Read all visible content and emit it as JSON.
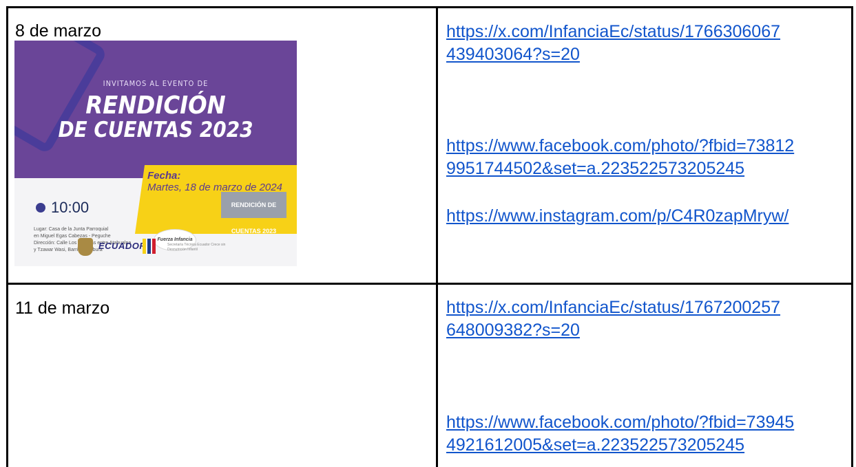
{
  "rows": [
    {
      "date": "8 de marzo",
      "poster": {
        "invite": "INVITAMOS AL EVENTO DE",
        "title_line1": "RENDICIÓN",
        "title_line2": "DE CUENTAS 2023",
        "time": "10:00",
        "fecha_label": "Fecha:",
        "fecha_value": "Martes, 18 de marzo de 2024",
        "info_lines": [
          "Lugar: Casa de la Junta Parroquial",
          "en Miguel Egas Cabezas - Peguche",
          "Dirección: Calle Los Corazas entre Atahualpa",
          "y Tzawar Wasi, Barrio Imbabura"
        ],
        "badge": "Fuerza Infancia",
        "rendicion_logo": "RENDICIÓN DE CUENTAS 2023",
        "country": "ECUADOR",
        "ministry": "Secretaría Técnica Ecuador Crece sin Desnutrición Infantil"
      },
      "links": [
        "https://x.com/InfanciaEc/status/1766306067\n439403064?s=20",
        "https://www.facebook.com/photo/?fbid=73812\n9951744502&set=a.223522573205245",
        "https://www.instagram.com/p/C4R0zapMryw/"
      ]
    },
    {
      "date": "11 de marzo",
      "links": [
        "https://x.com/InfanciaEc/status/1767200257\n648009382?s=20",
        "https://www.facebook.com/photo/?fbid=73945\n4921612005&set=a.223522573205245"
      ]
    }
  ],
  "colors": {
    "link": "#1155cc",
    "poster_purple": "#6a4598",
    "poster_yellow": "#f7d117"
  }
}
